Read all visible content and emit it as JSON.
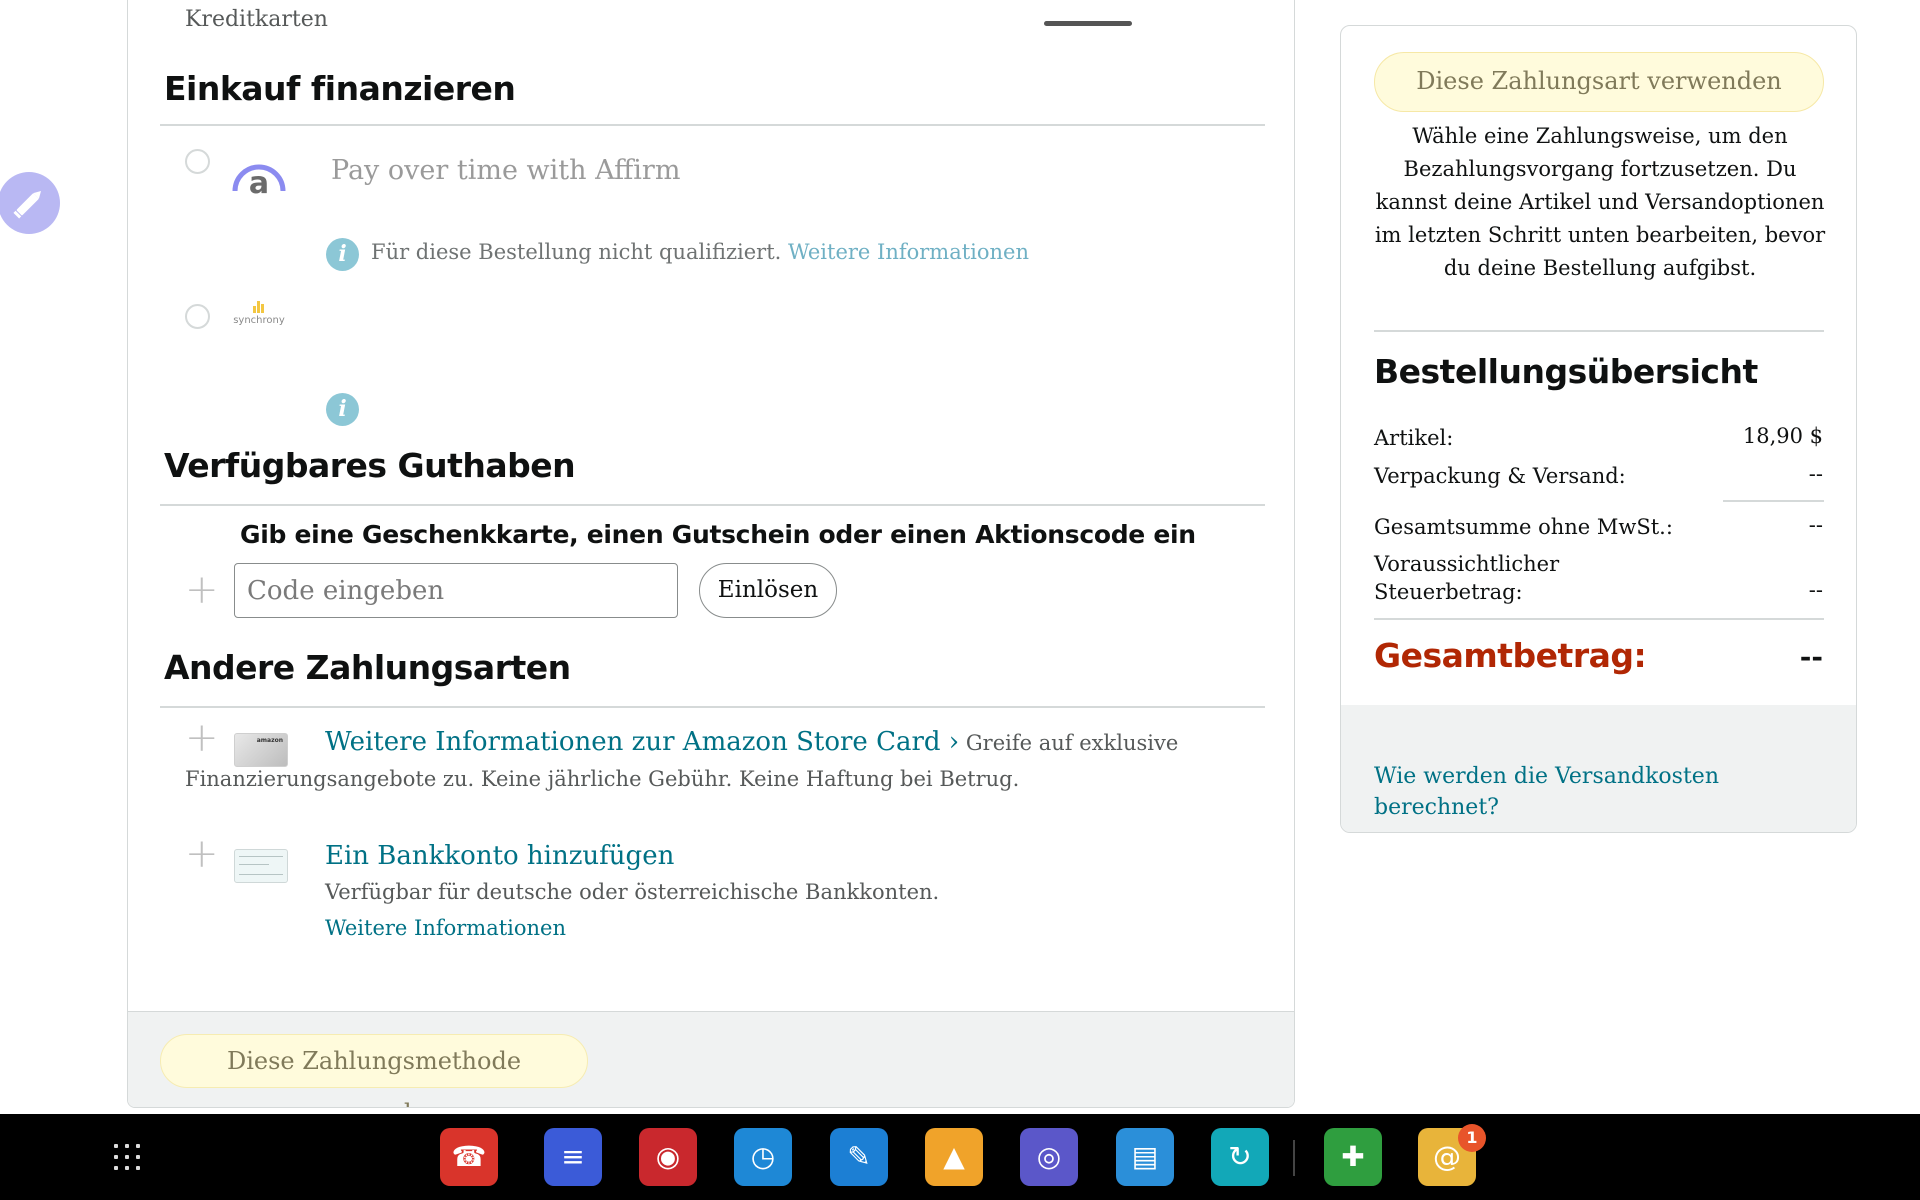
{
  "payment": {
    "prev_section_tail": "Kreditkarten",
    "financing": {
      "title": "Einkauf finanzieren",
      "affirm_label": "Pay over time with Affirm",
      "affirm_info": "Für diese Bestellung nicht qualifiziert.",
      "affirm_info_link": "Weitere Informationen",
      "synchrony_logo_text": "synchrony"
    },
    "balance": {
      "title": "Verfügbares Guthaben",
      "gift_label": "Gib eine Geschenkkarte, einen Gutschein oder einen Aktionscode ein",
      "code_placeholder": "Code eingeben",
      "redeem_label": "Einlösen"
    },
    "other": {
      "title": "Andere Zahlungsarten",
      "store_card_link": "Weitere Informationen zur Amazon Store Card ›",
      "store_card_desc": "Greife auf exklusive Finanzierungsangebote zu. Keine jährliche Gebühr. Keine Haftung bei Betrug.",
      "store_card_thumb_text": "amazon",
      "bank_link": "Ein Bankkonto hinzufügen",
      "bank_desc": "Verfügbar für deutsche oder österreichische Bankkonten.",
      "bank_more": "Weitere Informationen"
    },
    "use_method_label": "Diese Zahlungsmethode verwenden"
  },
  "summary": {
    "use_button": "Diese Zahlungsart verwenden",
    "description": "Wähle eine Zahlungsweise, um den Bezahlungsvorgang fortzusetzen. Du kannst deine Artikel und Versandoptionen im letzten Schritt unten bearbeiten, bevor du deine Bestellung aufgibst.",
    "title": "Bestellungsübersicht",
    "rows": [
      {
        "label": "Artikel:",
        "value": "18,90 $"
      },
      {
        "label": "Verpackung & Versand:",
        "value": "--"
      },
      {
        "label": "Gesamtsumme ohne MwSt.:",
        "value": "--"
      },
      {
        "label": "Voraussichtlicher Steuerbetrag:",
        "value": "--"
      }
    ],
    "total_label": "Gesamtbetrag:",
    "total_value": "--",
    "shipping_link": "Wie werden die Versandkosten berechnet?"
  },
  "taskbar": {
    "apps": [
      {
        "name": "contacts-phone",
        "icon": "phone-icon",
        "color": "#d9342b"
      },
      {
        "name": "messages",
        "icon": "message-icon",
        "color": "#3b5bd8"
      },
      {
        "name": "camera",
        "icon": "camera-icon",
        "color": "#c9282d"
      },
      {
        "name": "clock",
        "icon": "clock-icon",
        "color": "#1e88d6"
      },
      {
        "name": "notes",
        "icon": "pen-icon",
        "color": "#1c7fd4"
      },
      {
        "name": "gallery",
        "icon": "image-icon",
        "color": "#f0a32a"
      },
      {
        "name": "browser",
        "icon": "globe-icon",
        "color": "#5b57c9"
      },
      {
        "name": "files",
        "icon": "folder-icon",
        "color": "#2b8fd9"
      },
      {
        "name": "sync",
        "icon": "sync-icon",
        "color": "#12a8b8"
      },
      {
        "name": "game-launcher",
        "icon": "gamepad-icon",
        "color": "#2f9e3f"
      },
      {
        "name": "email",
        "icon": "mail-icon",
        "color": "#e8b43a"
      }
    ],
    "email_badge": "1"
  }
}
